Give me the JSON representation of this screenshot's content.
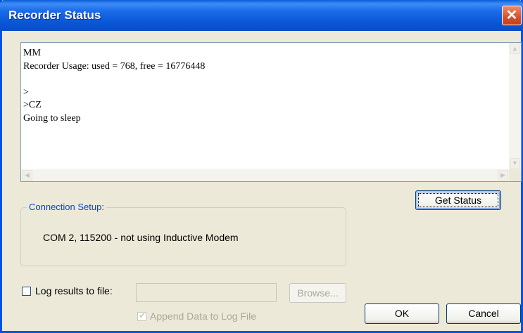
{
  "window": {
    "title": "Recorder Status",
    "close_glyph": "✕"
  },
  "console": {
    "lines": "MM\nRecorder Usage: used = 768, free = 16776448\n\n>\n>CZ\nGoing to sleep"
  },
  "get_status_button": "Get Status",
  "connection": {
    "legend": "Connection Setup:",
    "text": "COM 2, 115200 - not using Inductive Modem"
  },
  "log": {
    "checkbox_label": "Log results to file:",
    "file_path": "",
    "browse_label": "Browse...",
    "checked": false
  },
  "append": {
    "label": "Append Data to Log File",
    "checked": true
  },
  "ok_button": "OK",
  "cancel_button": "Cancel",
  "icons": {
    "close": "close-icon",
    "scroll_up": "arrow-up-icon",
    "scroll_down": "arrow-down-icon",
    "scroll_left": "arrow-left-icon",
    "scroll_right": "arrow-right-icon",
    "check": "checkmark-icon"
  },
  "colors": {
    "titlebar": "#0a5ed8",
    "window_bg": "#ece9d8",
    "legend_text": "#0046d5",
    "close_button": "#d8512a"
  }
}
